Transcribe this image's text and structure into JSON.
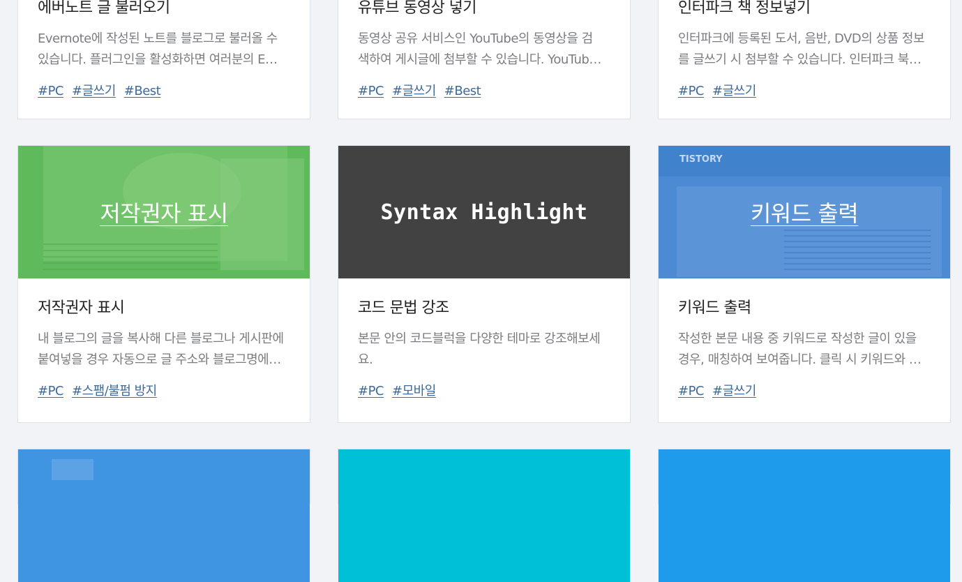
{
  "cards": [
    {
      "title": "에버노트 글 불러오기",
      "desc": [
        "Evernote에 작성된 노트를 블로그로 불러올 수",
        "있습니다. 플러그인을 활성화하면 여러분의 E…"
      ],
      "tags": [
        "#PC",
        "#글쓰기",
        "#Best"
      ]
    },
    {
      "title": "유튜브 동영상 넣기",
      "desc": [
        "동영상 공유 서비스인 YouTube의 동영상을 검",
        "색하여 게시글에 첨부할 수 있습니다. YouTub…"
      ],
      "tags": [
        "#PC",
        "#글쓰기",
        "#Best"
      ]
    },
    {
      "title": "인터파크 책 정보넣기",
      "desc": [
        "인터파크에 등록된 도서, 음반, DVD의 상품 정보",
        "를 글쓰기 시 첨부할 수 있습니다. 인터파크 북…"
      ],
      "tags": [
        "#PC",
        "#글쓰기"
      ]
    },
    {
      "thumb_label": "저작권자 표시",
      "thumb_color": "#5fba5c",
      "title": "저작권자 표시",
      "desc": [
        "내 블로그의 글을 복사해 다른 블로그나 게시판에",
        "붙여넣을 경우 자동으로 글 주소와 블로그명에…"
      ],
      "tags": [
        "#PC",
        "#스팸/불펌 방지"
      ]
    },
    {
      "thumb_label": "Syntax Highlight",
      "thumb_color": "#424242",
      "title": "코드 문법 강조",
      "desc": [
        "본문 안의 코드블럭을 다양한 테마로 강조해보세",
        "요."
      ],
      "tags": [
        "#PC",
        "#모바일"
      ]
    },
    {
      "thumb_label": "키워드 출력",
      "thumb_color": "#4c8bd4",
      "thumb_brand": "TISTORY",
      "title": "키워드 출력",
      "desc": [
        "작성한 본문 내용 중 키워드로 작성한 글이 있을",
        "경우, 매칭하여 보여줍니다. 클릭 시 키워드와 …"
      ],
      "tags": [
        "#PC",
        "#글쓰기"
      ]
    },
    {
      "thumb_color": "#3f95e2"
    },
    {
      "thumb_color": "#00c0d8"
    },
    {
      "thumb_color": "#1e9ceb"
    }
  ]
}
